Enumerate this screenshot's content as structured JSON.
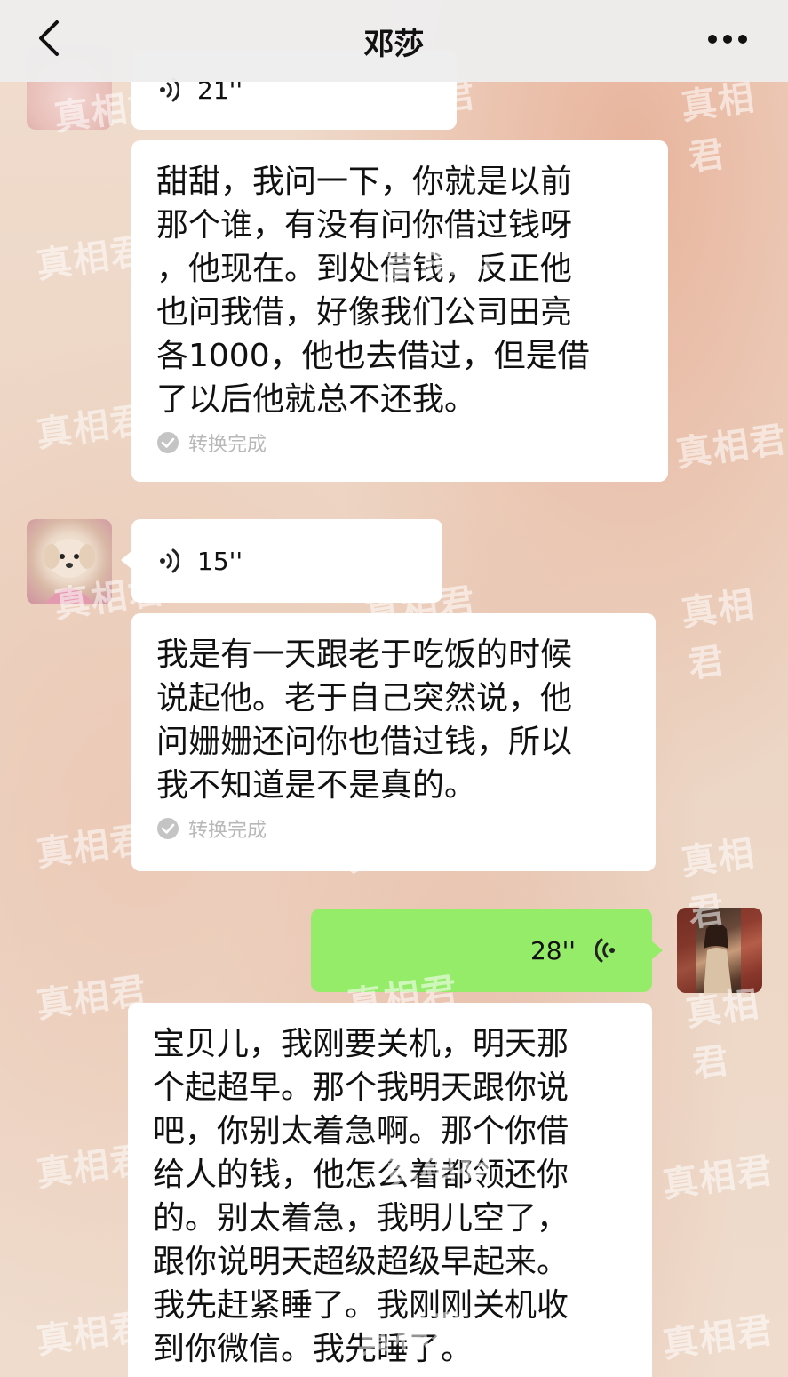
{
  "header": {
    "title": "邓莎"
  },
  "messages": [
    {
      "duration": "21''"
    },
    {
      "transcript": "甜甜，我问一下，你就是以前\n那个谁，有没有问你借过钱呀\n，他现在。到处借钱，反正他\n也问我借，好像我们公司田亮\n各1000，他也去借过，但是借\n了以后他就总不还我。",
      "status": "转换完成"
    },
    {
      "duration": "15''"
    },
    {
      "transcript": "我是有一天跟老于吃饭的时候\n说起他。老于自己突然说，他\n问姗姗还问你也借过钱，所以\n我不知道是不是真的。",
      "status": "转换完成"
    },
    {
      "duration": "28''"
    },
    {
      "transcript": "宝贝儿，我刚要关机，明天那\n个起超早。那个我明天跟你说\n吧，你别太着急啊。那个你借\n给人的钱，他怎么着都领还你\n的。别太着急，我明儿空了，\n跟你说明天超级超级早起来。\n我先赶紧睡了。我刚刚关机收\n到你微信。我先睡了。"
    }
  ],
  "watermark": "真相君",
  "colors": {
    "header_bg": "#ededed",
    "bubble_received": "#ffffff",
    "bubble_sent": "#95ec69",
    "status_text": "#b8b8b8"
  },
  "icons": {
    "back": "chevron-left-icon",
    "more": "more-dots-icon",
    "voice": "voice-wave-icon",
    "status": "check-circle-icon"
  }
}
